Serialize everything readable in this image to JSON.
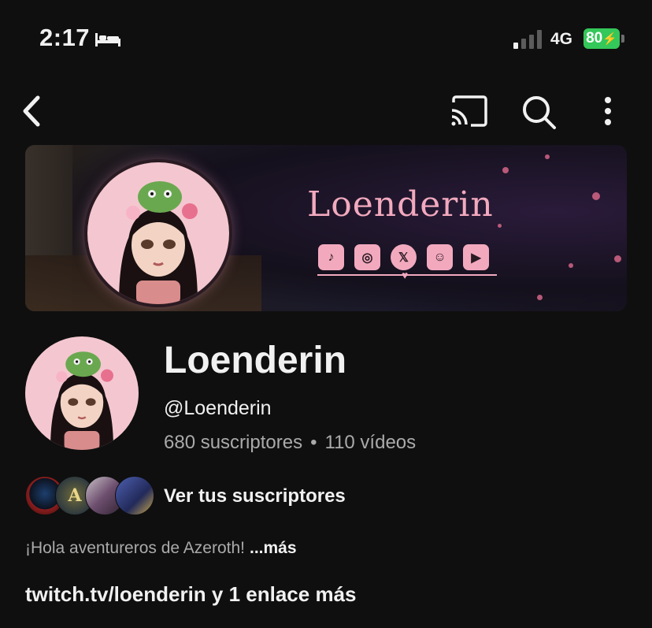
{
  "status_bar": {
    "time": "2:17",
    "network": "4G",
    "battery": "80"
  },
  "banner": {
    "title": "Loenderin",
    "socials": [
      "tiktok-icon",
      "instagram-icon",
      "x-icon",
      "discord-icon",
      "youtube-icon"
    ]
  },
  "channel": {
    "name": "Loenderin",
    "handle": "@Loenderin",
    "subscribers": "680 suscriptores",
    "separator": "•",
    "videos": "110 vídeos"
  },
  "subscribers_row": {
    "label": "Ver tus suscriptores"
  },
  "description": {
    "text": "¡Hola aventureros de Azeroth!",
    "more": "...más"
  },
  "links": {
    "primary": "twitch.tv/loenderin",
    "rest": " y 1 enlace más"
  },
  "colors": {
    "background": "#0f0f0f",
    "text": "#f1f1f1",
    "secondary": "#aaaaaa",
    "battery": "#34c759",
    "banner_pink": "#f2a9be"
  }
}
